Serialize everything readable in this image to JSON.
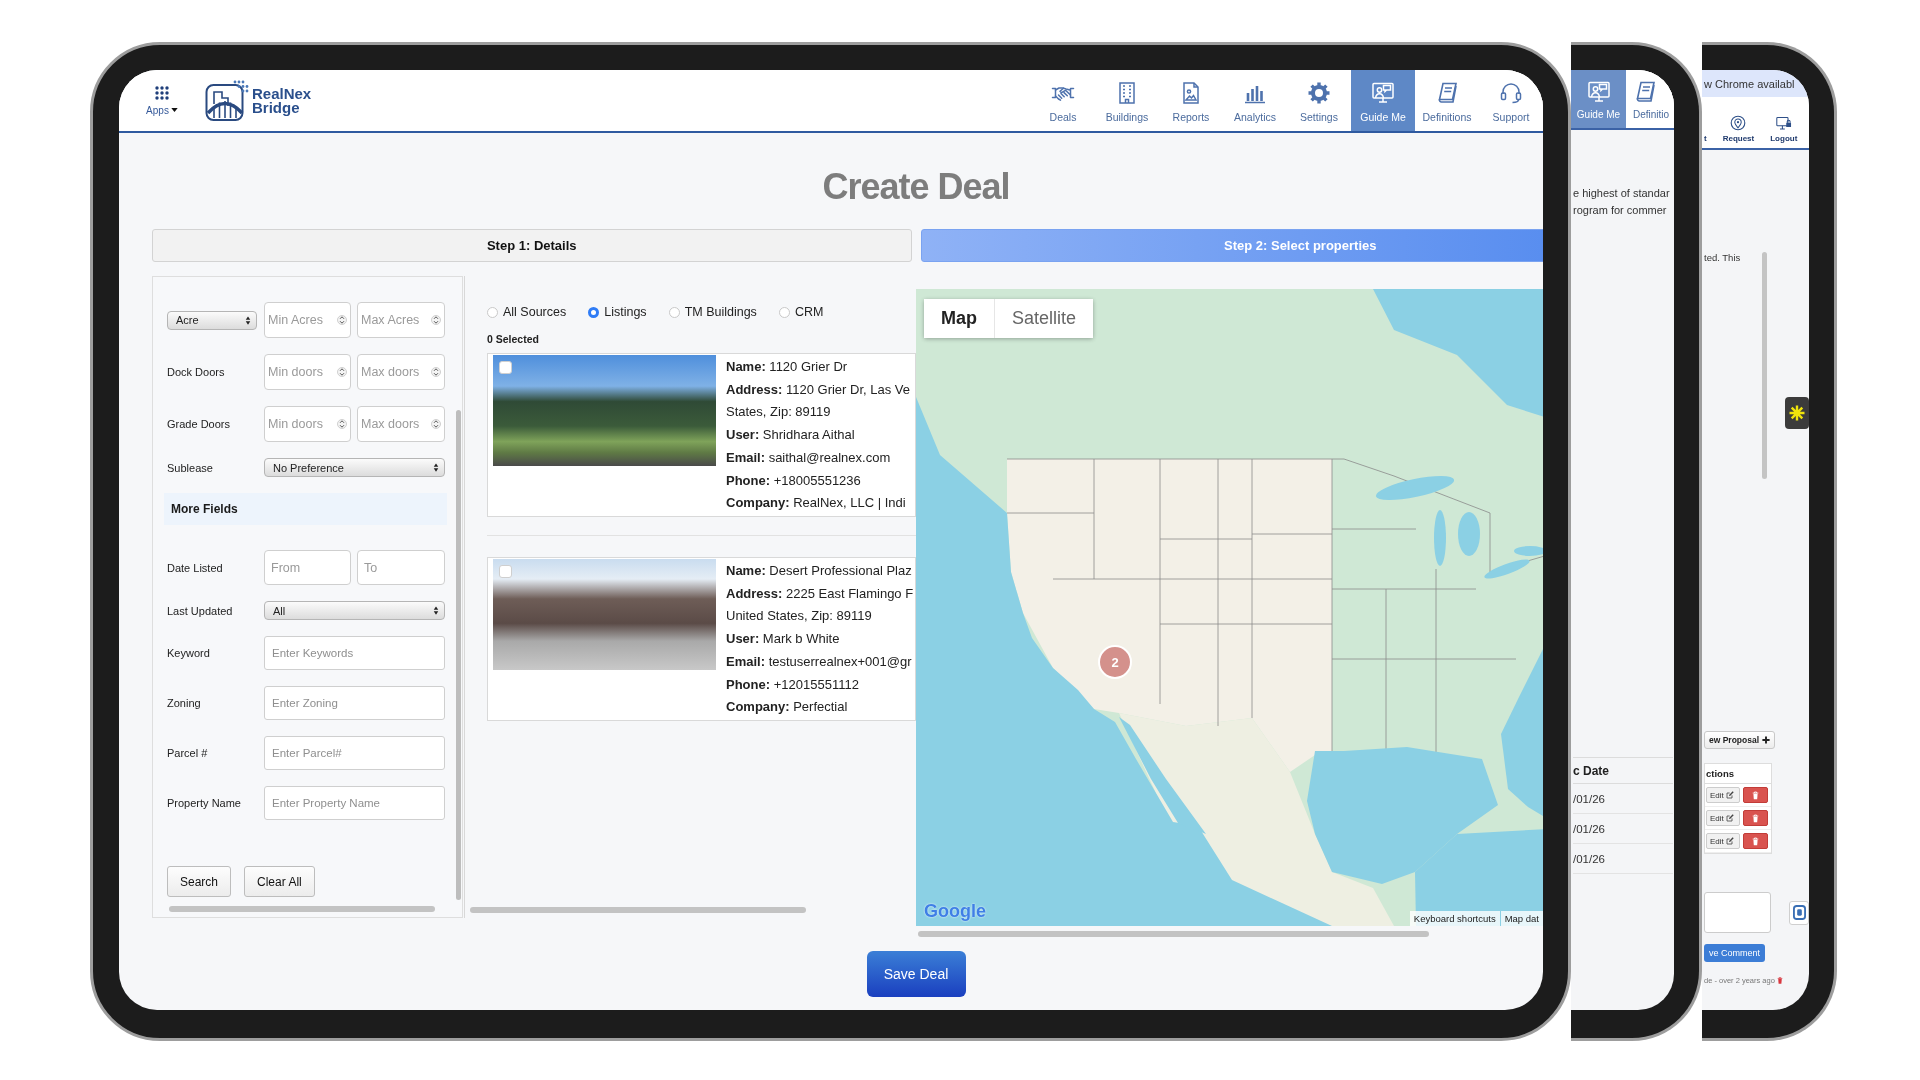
{
  "main_screen": {
    "header": {
      "apps_label": "Apps",
      "logo_lines": [
        "RealNex",
        "Bridge"
      ],
      "nav": [
        {
          "label": "Deals",
          "selected": false
        },
        {
          "label": "Buildings",
          "selected": false
        },
        {
          "label": "Reports",
          "selected": false
        },
        {
          "label": "Analytics",
          "selected": false
        },
        {
          "label": "Settings",
          "selected": false
        },
        {
          "label": "Guide Me",
          "selected": true
        },
        {
          "label": "Definitions",
          "selected": false
        },
        {
          "label": "Support",
          "selected": false
        }
      ]
    },
    "title": "Create Deal",
    "steps": [
      {
        "label": "Step 1: Details",
        "selected": false
      },
      {
        "label": "Step 2: Select properties",
        "selected": true
      }
    ],
    "filters": {
      "rows": [
        {
          "kind": "range",
          "unit": "Acre",
          "min_placeholder": "Min Acres",
          "max_placeholder": "Max Acres"
        },
        {
          "kind": "range",
          "label": "Dock Doors",
          "min_placeholder": "Min doors",
          "max_placeholder": "Max doors"
        },
        {
          "kind": "range",
          "label": "Grade Doors",
          "min_placeholder": "Min doors",
          "max_placeholder": "Max doors"
        },
        {
          "kind": "select",
          "label": "Sublease",
          "value": "No Preference"
        },
        {
          "kind": "section",
          "label": "More Fields"
        },
        {
          "kind": "date_range",
          "label": "Date Listed",
          "min_placeholder": "From",
          "max_placeholder": "To"
        },
        {
          "kind": "select",
          "label": "Last Updated",
          "value": "All"
        },
        {
          "kind": "text",
          "label": "Keyword",
          "placeholder": "Enter Keywords"
        },
        {
          "kind": "text",
          "label": "Zoning",
          "placeholder": "Enter Zoning"
        },
        {
          "kind": "text",
          "label": "Parcel #",
          "placeholder": "Enter Parcel#"
        },
        {
          "kind": "text",
          "label": "Property Name",
          "placeholder": "Enter Property Name"
        }
      ],
      "buttons": [
        "Search",
        "Clear All"
      ]
    },
    "sources": [
      {
        "label": "All Sources",
        "selected": false
      },
      {
        "label": "Listings",
        "selected": true
      },
      {
        "label": "TM Buildings",
        "selected": false
      },
      {
        "label": "CRM",
        "selected": false
      }
    ],
    "selected_count": "0 Selected",
    "properties": [
      {
        "checked": false,
        "lines": [
          "**Name:** 1120 Grier Dr",
          "**Address:** 1120 Grier Dr, Las Ve",
          "States, Zip: 89119",
          "**User:** Shridhara Aithal",
          "**Email:** saithal@realnex.com",
          "**Phone:** +18005551236",
          "**Company:** RealNex, LLC | Indi"
        ]
      },
      {
        "checked": false,
        "lines": [
          "**Name:** Desert Professional Plaz",
          "**Address:** 2225 East Flamingo F",
          "United States, Zip: 89119",
          "**User:** Mark b White",
          "**Email:** testuserrealnex+001@gr",
          "**Phone:** +12015551112",
          "**Company:** Perfectial"
        ]
      }
    ],
    "map": {
      "view_options": [
        {
          "label": "Map",
          "selected": true
        },
        {
          "label": "Satellite",
          "selected": false
        }
      ],
      "cluster_count": "2",
      "brand": "Google",
      "footer_links": [
        "Keyboard shortcuts",
        "Map dat"
      ]
    },
    "save_button": "Save Deal"
  },
  "guide_tablet": {
    "nav": [
      {
        "label": "Guide Me",
        "selected": true
      },
      {
        "label": "Definitio",
        "selected": false
      }
    ],
    "text_lines": [
      "e highest of standar",
      "rogram for commer"
    ],
    "table": {
      "column": "c Date",
      "rows": [
        "/01/26",
        "/01/26",
        "/01/26"
      ]
    }
  },
  "comments_tablet": {
    "banner": "w Chrome availabl",
    "nav": [
      "t",
      "Request",
      "Logout"
    ],
    "note": "ted. This",
    "proposal_button": "ew Proposal",
    "actions": {
      "column": "ctions",
      "rows": [
        "Edit",
        "Edit",
        "Edit"
      ]
    },
    "comment_button": "ve Comment",
    "comment_meta": "de - over 2 years ago"
  }
}
